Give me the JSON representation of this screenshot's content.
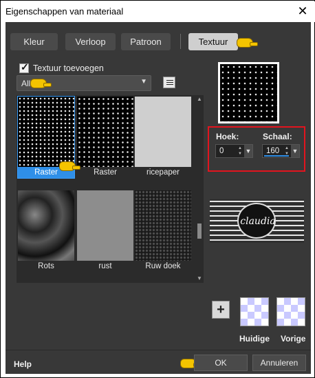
{
  "window": {
    "title": "Eigenschappen van materiaal",
    "close_icon": "close-icon"
  },
  "tabs": [
    {
      "label": "Kleur",
      "active": false
    },
    {
      "label": "Verloop",
      "active": false
    },
    {
      "label": "Patroon",
      "active": false
    },
    {
      "label": "Textuur",
      "active": true
    }
  ],
  "texture": {
    "checkbox_label": "Textuur toevoegen",
    "checked": true,
    "category": "Alle",
    "options_icon": "list-options-icon"
  },
  "thumbnails": [
    {
      "label": "Raster",
      "selected": true
    },
    {
      "label": "Raster",
      "selected": false
    },
    {
      "label": "ricepaper",
      "selected": false
    },
    {
      "label": "Rots",
      "selected": false
    },
    {
      "label": "rust",
      "selected": false
    },
    {
      "label": "Ruw doek",
      "selected": false
    }
  ],
  "settings": {
    "angle_label": "Hoek:",
    "angle_value": "0",
    "scale_label": "Schaal:",
    "scale_value": "160"
  },
  "logo": {
    "text": "claudia"
  },
  "swatches": {
    "current_label": "Huidige",
    "previous_label": "Vorige"
  },
  "footer": {
    "help": "Help",
    "ok": "OK",
    "cancel": "Annuleren"
  },
  "colors": {
    "accent": "#2f8fe8",
    "highlight_box": "#e3141e",
    "background": "#383838"
  }
}
